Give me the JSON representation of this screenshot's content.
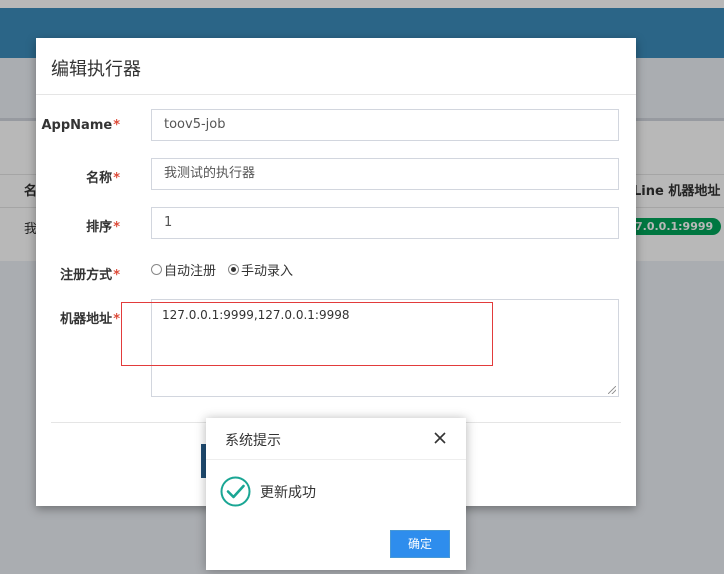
{
  "background": {
    "table_header_left": "名",
    "table_header_right": "Line 机器地址",
    "table_row_left": "我",
    "row_badge": "7.0.0.1:9999",
    "badge_color": "#00a65a",
    "navbar_color": "#3c8dbc"
  },
  "edit_modal": {
    "title": "编辑执行器",
    "required_mark": "*",
    "fields": {
      "appname": {
        "label": "AppName",
        "value": "toov5-job"
      },
      "name": {
        "label": "名称",
        "value": "我测试的执行器"
      },
      "order": {
        "label": "排序",
        "value": "1"
      },
      "register_type": {
        "label": "注册方式",
        "options": [
          "自动注册",
          "手动录入"
        ],
        "selected": "手动录入"
      },
      "address_list": {
        "label": "机器地址",
        "value": "127.0.0.1:9999,127.0.0.1:9998"
      }
    }
  },
  "alert": {
    "title": "系统提示",
    "message": "更新成功",
    "confirm_label": "确定",
    "icon": "success-check-icon",
    "icon_color": "#1aa694",
    "button_color": "#2e8ded"
  }
}
